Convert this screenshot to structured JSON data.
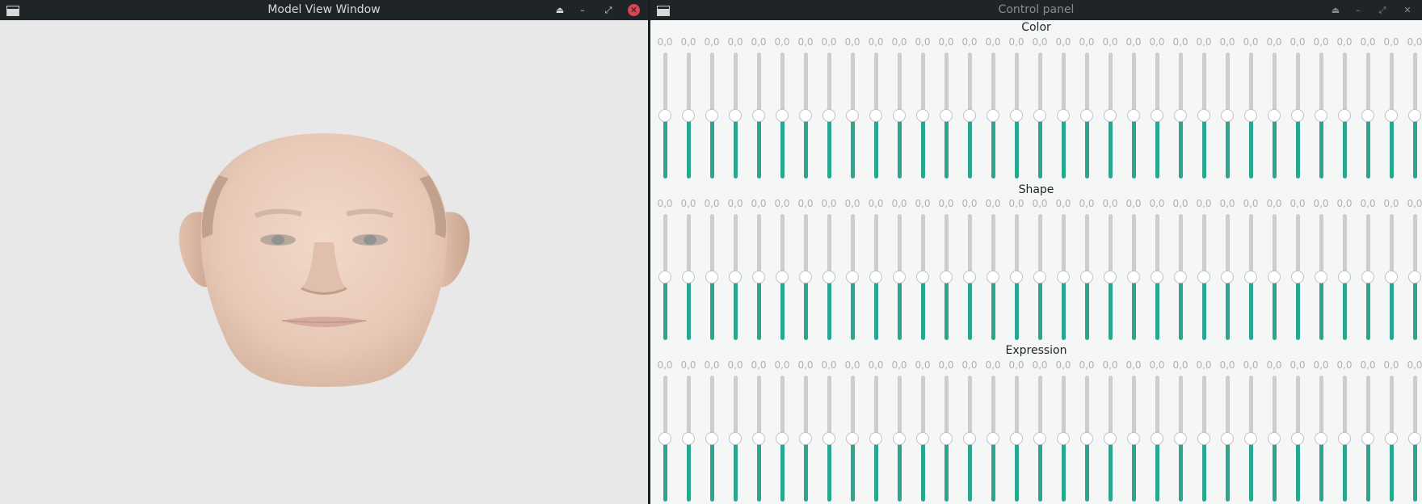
{
  "left_window": {
    "title": "Model View Window",
    "buttons": {
      "keep_above": "⏏",
      "minimize": "–",
      "maximize": "⤢",
      "close": "✕"
    },
    "content": "3d-face-render"
  },
  "right_window": {
    "title": "Control panel",
    "buttons": {
      "keep_above": "⏏",
      "minimize": "–",
      "maximize": "⤢",
      "close": "✕"
    }
  },
  "sections": [
    {
      "title": "Color",
      "sliders": [
        {
          "value_label": "0,0",
          "level": 0.5
        },
        {
          "value_label": "0,0",
          "level": 0.5
        },
        {
          "value_label": "0,0",
          "level": 0.5
        },
        {
          "value_label": "0,0",
          "level": 0.5
        },
        {
          "value_label": "0,0",
          "level": 0.5
        },
        {
          "value_label": "0,0",
          "level": 0.5
        },
        {
          "value_label": "0,0",
          "level": 0.5
        },
        {
          "value_label": "0,0",
          "level": 0.5
        },
        {
          "value_label": "0,0",
          "level": 0.5
        },
        {
          "value_label": "0,0",
          "level": 0.5
        },
        {
          "value_label": "0,0",
          "level": 0.5
        },
        {
          "value_label": "0,0",
          "level": 0.5
        },
        {
          "value_label": "0,0",
          "level": 0.5
        },
        {
          "value_label": "0,0",
          "level": 0.5
        },
        {
          "value_label": "0,0",
          "level": 0.5
        },
        {
          "value_label": "0,0",
          "level": 0.5
        },
        {
          "value_label": "0,0",
          "level": 0.5
        },
        {
          "value_label": "0,0",
          "level": 0.5
        },
        {
          "value_label": "0,0",
          "level": 0.5
        },
        {
          "value_label": "0,0",
          "level": 0.5
        },
        {
          "value_label": "0,0",
          "level": 0.5
        },
        {
          "value_label": "0,0",
          "level": 0.5
        },
        {
          "value_label": "0,0",
          "level": 0.5
        },
        {
          "value_label": "0,0",
          "level": 0.5
        },
        {
          "value_label": "0,0",
          "level": 0.5
        },
        {
          "value_label": "0,0",
          "level": 0.5
        },
        {
          "value_label": "0,0",
          "level": 0.5
        },
        {
          "value_label": "0,0",
          "level": 0.5
        },
        {
          "value_label": "0,0",
          "level": 0.5
        },
        {
          "value_label": "0,0",
          "level": 0.5
        },
        {
          "value_label": "0,0",
          "level": 0.5
        },
        {
          "value_label": "0,0",
          "level": 0.5
        },
        {
          "value_label": "0,0",
          "level": 0.5
        },
        {
          "value_label": "0,0",
          "level": 0.5
        },
        {
          "value_label": "0,0",
          "level": 0.5
        },
        {
          "value_label": "0,0",
          "level": 0.5
        },
        {
          "value_label": "0,0",
          "level": 0.5
        }
      ]
    },
    {
      "title": "Shape",
      "sliders": [
        {
          "value_label": "0,0",
          "level": 0.5
        },
        {
          "value_label": "0,0",
          "level": 0.5
        },
        {
          "value_label": "0,0",
          "level": 0.5
        },
        {
          "value_label": "0,0",
          "level": 0.5
        },
        {
          "value_label": "0,0",
          "level": 0.5
        },
        {
          "value_label": "0,0",
          "level": 0.5
        },
        {
          "value_label": "0,0",
          "level": 0.5
        },
        {
          "value_label": "0,0",
          "level": 0.5
        },
        {
          "value_label": "0,0",
          "level": 0.5
        },
        {
          "value_label": "0,0",
          "level": 0.5
        },
        {
          "value_label": "0,0",
          "level": 0.5
        },
        {
          "value_label": "0,0",
          "level": 0.5
        },
        {
          "value_label": "0,0",
          "level": 0.5
        },
        {
          "value_label": "0,0",
          "level": 0.5
        },
        {
          "value_label": "0,0",
          "level": 0.5
        },
        {
          "value_label": "0,0",
          "level": 0.5
        },
        {
          "value_label": "0,0",
          "level": 0.5
        },
        {
          "value_label": "0,0",
          "level": 0.5
        },
        {
          "value_label": "0,0",
          "level": 0.5
        },
        {
          "value_label": "0,0",
          "level": 0.5
        },
        {
          "value_label": "0,0",
          "level": 0.5
        },
        {
          "value_label": "0,0",
          "level": 0.5
        },
        {
          "value_label": "0,0",
          "level": 0.5
        },
        {
          "value_label": "0,0",
          "level": 0.5
        },
        {
          "value_label": "0,0",
          "level": 0.5
        },
        {
          "value_label": "0,0",
          "level": 0.5
        },
        {
          "value_label": "0,0",
          "level": 0.5
        },
        {
          "value_label": "0,0",
          "level": 0.5
        },
        {
          "value_label": "0,0",
          "level": 0.5
        },
        {
          "value_label": "0,0",
          "level": 0.5
        },
        {
          "value_label": "0,0",
          "level": 0.5
        },
        {
          "value_label": "0,0",
          "level": 0.5
        },
        {
          "value_label": "0,0",
          "level": 0.5
        },
        {
          "value_label": "0,0",
          "level": 0.5
        },
        {
          "value_label": "0,0",
          "level": 0.5
        },
        {
          "value_label": "0,0",
          "level": 0.5
        },
        {
          "value_label": "0,0",
          "level": 0.5
        }
      ]
    },
    {
      "title": "Expression",
      "sliders": [
        {
          "value_label": "0,0",
          "level": 0.5
        },
        {
          "value_label": "0,0",
          "level": 0.5
        },
        {
          "value_label": "0,0",
          "level": 0.5
        },
        {
          "value_label": "0,0",
          "level": 0.5
        },
        {
          "value_label": "0,0",
          "level": 0.5
        },
        {
          "value_label": "0,0",
          "level": 0.5
        },
        {
          "value_label": "0,0",
          "level": 0.5
        },
        {
          "value_label": "0,0",
          "level": 0.5
        },
        {
          "value_label": "0,0",
          "level": 0.5
        },
        {
          "value_label": "0,0",
          "level": 0.5
        },
        {
          "value_label": "0,0",
          "level": 0.5
        },
        {
          "value_label": "0,0",
          "level": 0.5
        },
        {
          "value_label": "0,0",
          "level": 0.5
        },
        {
          "value_label": "0,0",
          "level": 0.5
        },
        {
          "value_label": "0,0",
          "level": 0.5
        },
        {
          "value_label": "0,0",
          "level": 0.5
        },
        {
          "value_label": "0,0",
          "level": 0.5
        },
        {
          "value_label": "0,0",
          "level": 0.5
        },
        {
          "value_label": "0,0",
          "level": 0.5
        },
        {
          "value_label": "0,0",
          "level": 0.5
        },
        {
          "value_label": "0,0",
          "level": 0.5
        },
        {
          "value_label": "0,0",
          "level": 0.5
        },
        {
          "value_label": "0,0",
          "level": 0.5
        },
        {
          "value_label": "0,0",
          "level": 0.5
        },
        {
          "value_label": "0,0",
          "level": 0.5
        },
        {
          "value_label": "0,0",
          "level": 0.5
        },
        {
          "value_label": "0,0",
          "level": 0.5
        },
        {
          "value_label": "0,0",
          "level": 0.5
        },
        {
          "value_label": "0,0",
          "level": 0.5
        },
        {
          "value_label": "0,0",
          "level": 0.5
        },
        {
          "value_label": "0,0",
          "level": 0.5
        },
        {
          "value_label": "0,0",
          "level": 0.5
        },
        {
          "value_label": "0,0",
          "level": 0.5
        },
        {
          "value_label": "0,0",
          "level": 0.5
        },
        {
          "value_label": "0,0",
          "level": 0.5
        },
        {
          "value_label": "0,0",
          "level": 0.5
        },
        {
          "value_label": "0,0",
          "level": 0.5
        }
      ]
    }
  ],
  "colors": {
    "accent": "#2aa58f",
    "track": "#cdcdcd",
    "titlebar": "#1f2426",
    "close": "#da4453"
  }
}
